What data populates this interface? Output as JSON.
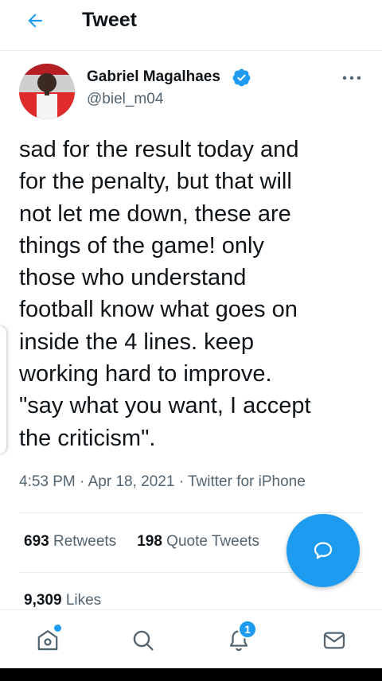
{
  "header": {
    "title": "Tweet",
    "back_icon": "arrow-left-icon"
  },
  "author": {
    "display_name": "Gabriel Magalhaes",
    "handle": "@biel_m04",
    "verified": true,
    "verified_icon": "verified-badge-icon"
  },
  "tweet": {
    "text": "sad for the result today and\nfor the penalty, but that will\nnot let me down, these are\nthings of the game!  only\nthose who understand\nfootball know what goes on\ninside the 4 lines.  keep\nworking hard to improve.\n\"say what you want, I accept\nthe criticism\".",
    "time": "4:53 PM",
    "date": "Apr 18, 2021",
    "source": "Twitter for iPhone",
    "separator": " · "
  },
  "stats": {
    "retweets_count": "693",
    "retweets_label": "Retweets",
    "quote_count": "198",
    "quote_label": "Quote Tweets",
    "likes_count": "9,309",
    "likes_label": "Likes"
  },
  "fab": {
    "icon": "compose-reply-icon"
  },
  "nav": {
    "items": [
      {
        "icon": "home-icon"
      },
      {
        "icon": "search-icon"
      },
      {
        "icon": "bell-icon",
        "badge": "1"
      },
      {
        "icon": "mail-icon"
      }
    ]
  },
  "colors": {
    "accent": "#1d9bf0",
    "text": "#0f1419",
    "secondary": "#536471",
    "divider": "#e6ecf0"
  }
}
